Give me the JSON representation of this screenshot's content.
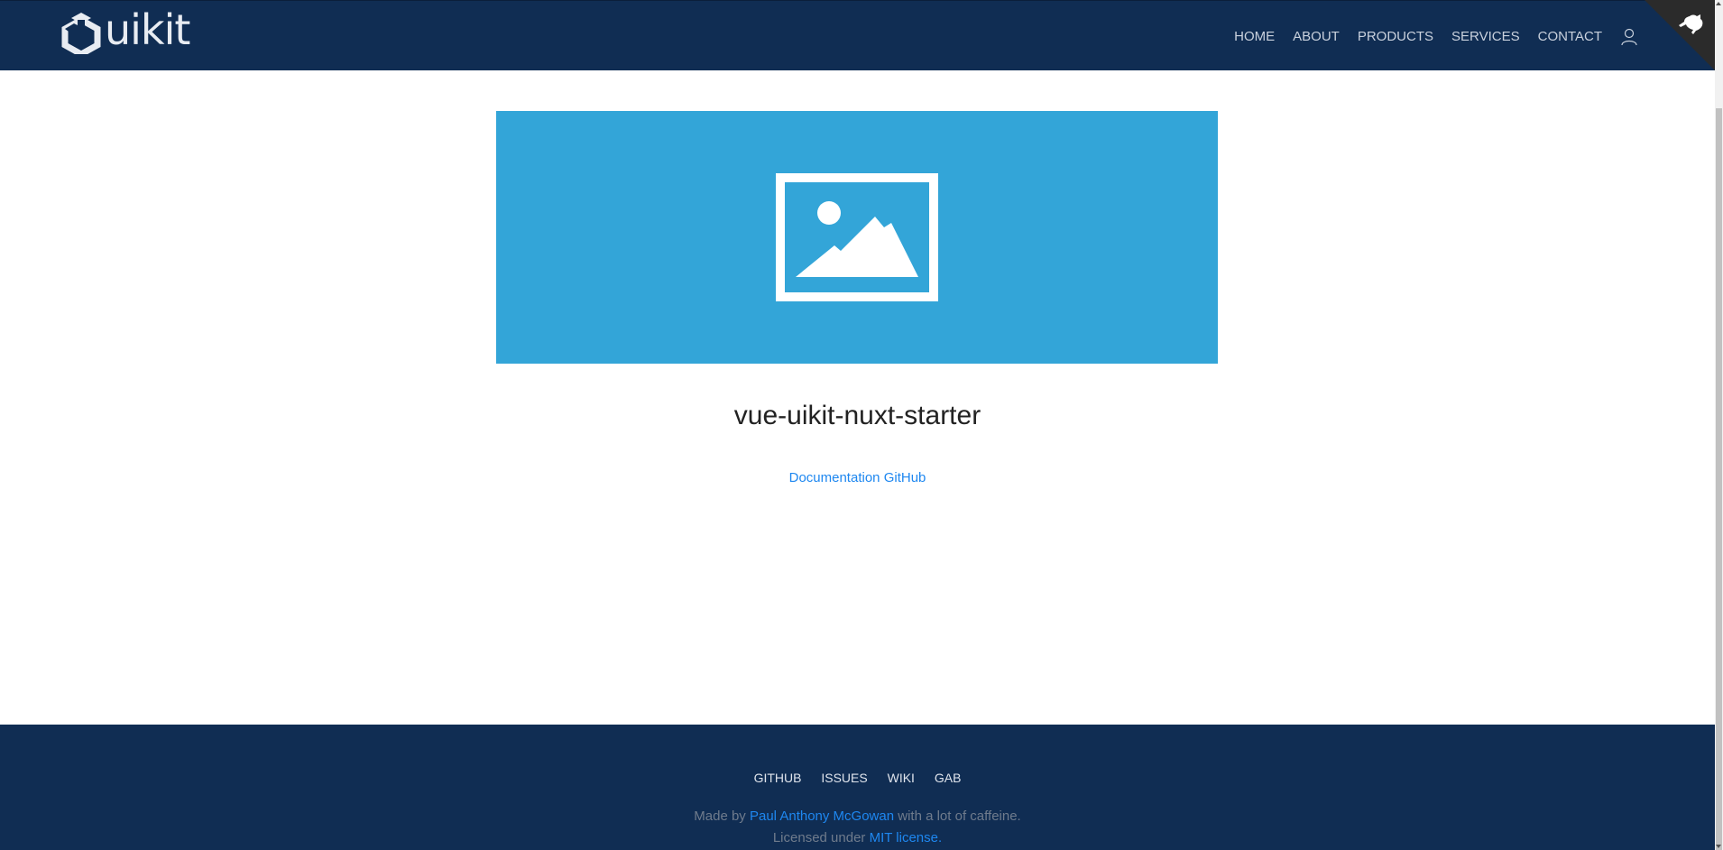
{
  "header": {
    "logo_text": "uikit",
    "nav": [
      {
        "label": "HOME"
      },
      {
        "label": "ABOUT"
      },
      {
        "label": "PRODUCTS"
      },
      {
        "label": "SERVICES"
      },
      {
        "label": "CONTACT"
      }
    ],
    "user_icon": "user-icon",
    "corner_icon": "github-icon"
  },
  "hero": {
    "icon": "image-placeholder-icon",
    "color": "#33a5d8"
  },
  "main": {
    "title": "vue-uikit-nuxt-starter",
    "link_documentation": "Documentation",
    "link_github": "GitHub"
  },
  "footer": {
    "nav": [
      {
        "label": "GITHUB"
      },
      {
        "label": "ISSUES"
      },
      {
        "label": "WIKI"
      },
      {
        "label": "GAB"
      }
    ],
    "made_by_prefix": "Made by",
    "author": "Paul Anthony McGowan",
    "made_by_suffix": "with a lot of caffeine.",
    "license_prefix": "Licensed under",
    "license_link": "MIT license",
    "license_suffix": "."
  },
  "colors": {
    "navbar_bg": "#102d53",
    "link": "#1e87f0",
    "hero": "#33a5d8"
  }
}
